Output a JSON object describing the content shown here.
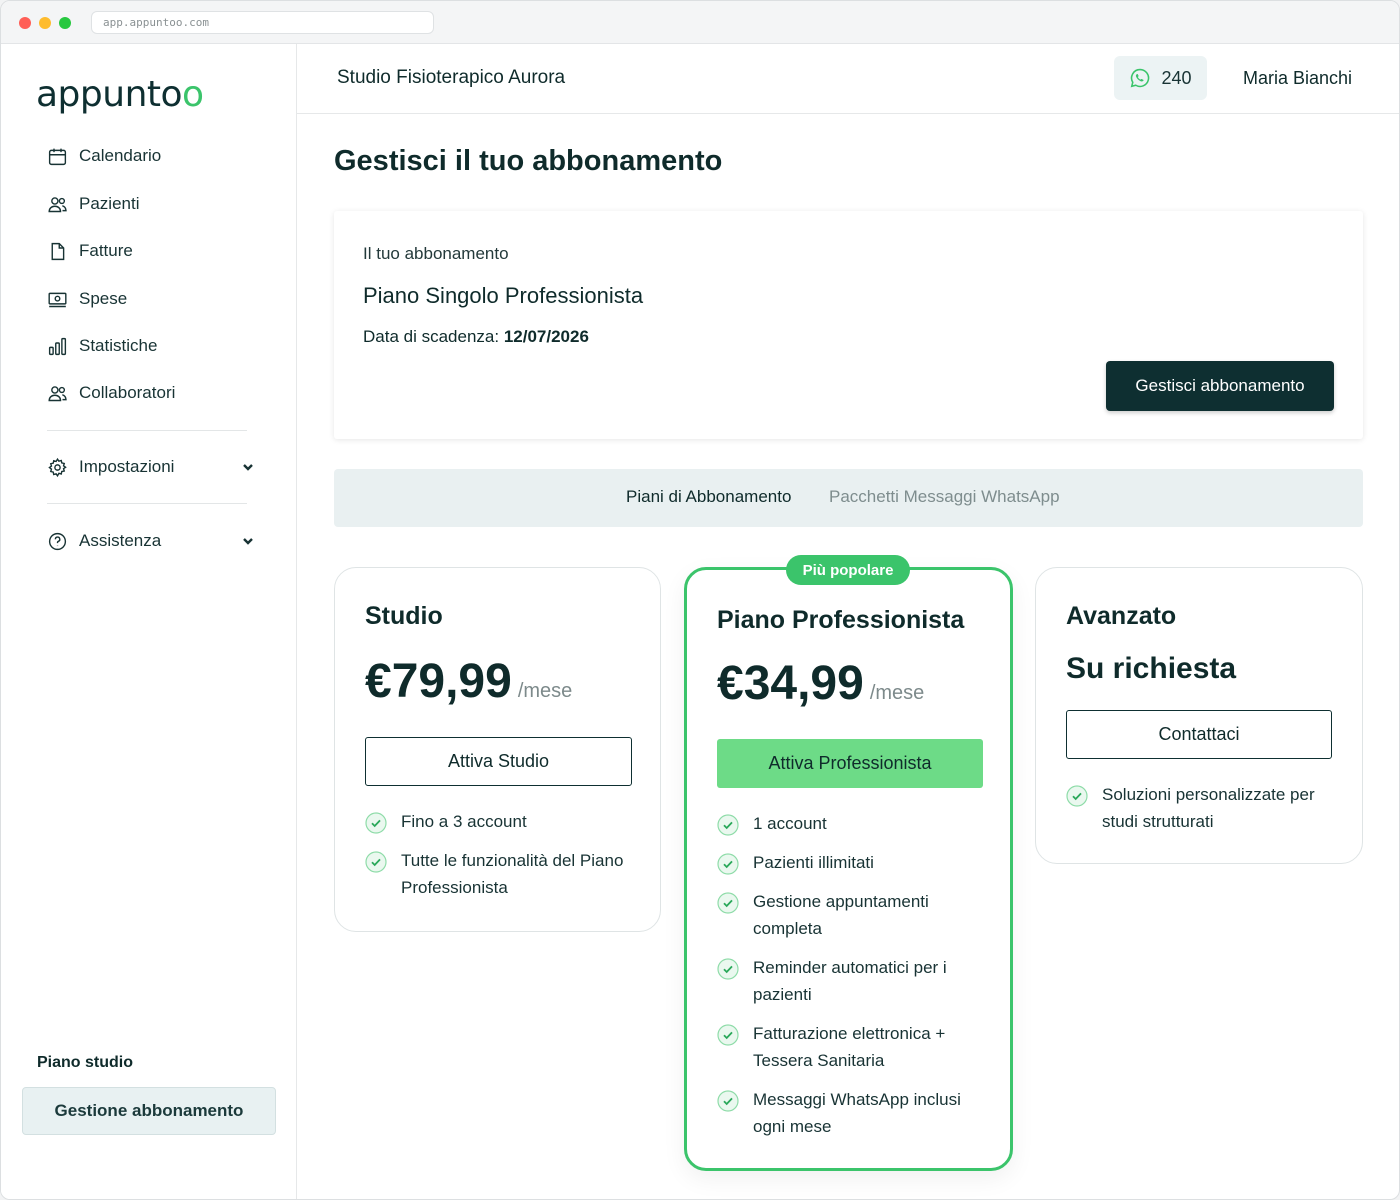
{
  "browser": {
    "url": "app.appuntoo.com"
  },
  "brand": {
    "logo_a": "appunt",
    "logo_o1": "o",
    "logo_o2": "o",
    "accent": "#3bc46b",
    "dark": "#0e2f31"
  },
  "sidebar": {
    "items": [
      {
        "label": "Calendario",
        "icon": "calendar-icon"
      },
      {
        "label": "Pazienti",
        "icon": "users-icon"
      },
      {
        "label": "Fatture",
        "icon": "document-icon"
      },
      {
        "label": "Spese",
        "icon": "money-icon"
      },
      {
        "label": "Statistiche",
        "icon": "chart-icon"
      },
      {
        "label": "Collaboratori",
        "icon": "users-icon"
      }
    ],
    "settings": {
      "label": "Impostazioni",
      "icon": "gear-icon"
    },
    "help": {
      "label": "Assistenza",
      "icon": "help-icon"
    },
    "plan_label": "Piano studio",
    "manage_button": "Gestione abbonamento"
  },
  "topbar": {
    "studio_name": "Studio Fisioterapico Aurora",
    "whatsapp_count": "240",
    "user_name": "Maria Bianchi"
  },
  "page": {
    "title": "Gestisci il tuo abbonamento",
    "subscription": {
      "small_label": "Il tuo abbonamento",
      "plan_name": "Piano Singolo Professionista",
      "date_label": "Data di scadenza:",
      "date_value": "12/07/2026",
      "button": "Gestisci abbonamento"
    },
    "tabs": [
      {
        "label": "Piani di Abbonamento",
        "active": true
      },
      {
        "label": "Pacchetti Messaggi WhatsApp",
        "active": false
      }
    ],
    "plans": [
      {
        "title": "Studio",
        "price": "€79,99",
        "unit": "/mese",
        "button": "Attiva Studio",
        "features": [
          "Fino a 3 account",
          "Tutte le funzionalità del Piano Professionista"
        ]
      },
      {
        "badge": "Più popolare",
        "title": "Piano Professionista",
        "price": "€34,99",
        "unit": "/mese",
        "button": "Attiva Professionista",
        "features": [
          "1 account",
          "Pazienti illimitati",
          "Gestione appuntamenti completa",
          "Reminder automatici per i pazienti",
          "Fatturazione elettronica + Tessera Sanitaria",
          "Messaggi WhatsApp inclusi ogni mese"
        ]
      },
      {
        "title": "Avanzato",
        "price_text": "Su richiesta",
        "button": "Contattaci",
        "features": [
          "Soluzioni personalizzate per studi strutturati"
        ]
      }
    ]
  }
}
